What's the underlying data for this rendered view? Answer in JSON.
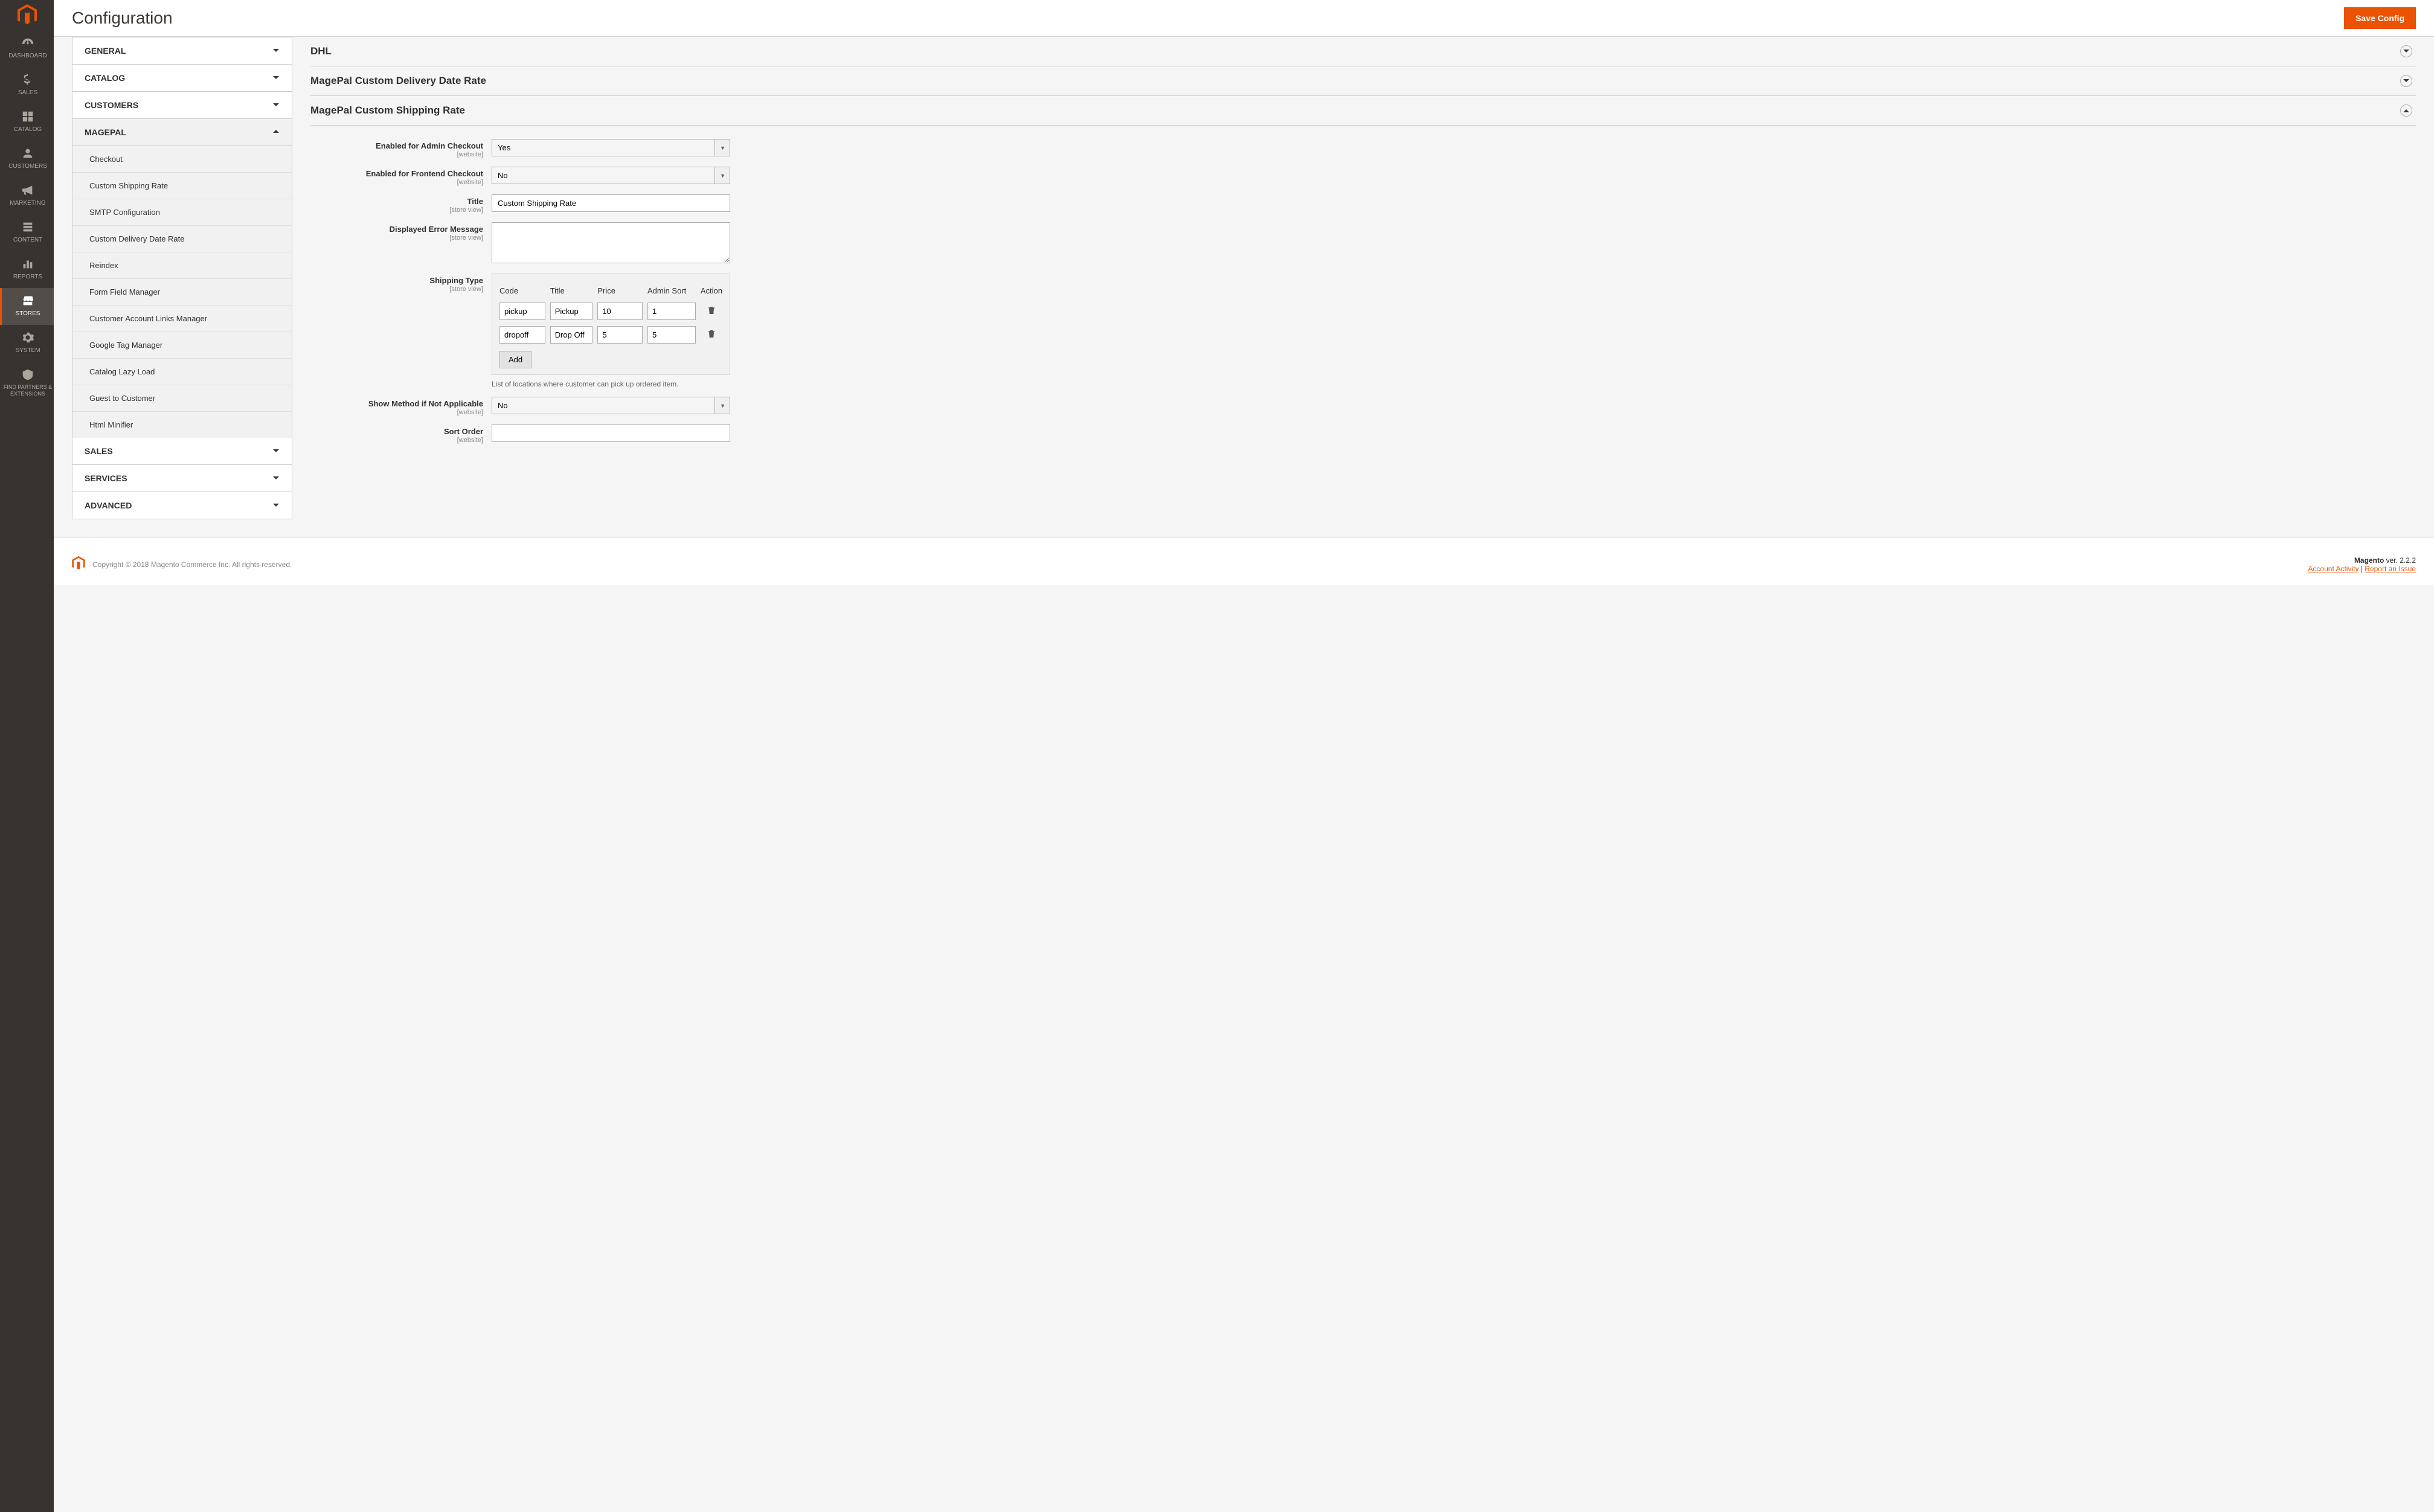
{
  "pageTitle": "Configuration",
  "saveButton": "Save Config",
  "sidebar": {
    "items": [
      {
        "label": "Dashboard"
      },
      {
        "label": "Sales"
      },
      {
        "label": "Catalog"
      },
      {
        "label": "Customers"
      },
      {
        "label": "Marketing"
      },
      {
        "label": "Content"
      },
      {
        "label": "Reports"
      },
      {
        "label": "Stores"
      },
      {
        "label": "System"
      },
      {
        "label": "Find Partners & Extensions"
      }
    ]
  },
  "configNav": {
    "groups": [
      {
        "label": "General"
      },
      {
        "label": "Catalog"
      },
      {
        "label": "Customers"
      },
      {
        "label": "MagePal",
        "expanded": true,
        "items": [
          "Checkout",
          "Custom Shipping Rate",
          "SMTP Configuration",
          "Custom Delivery Date Rate",
          "Reindex",
          "Form Field Manager",
          "Customer Account Links Manager",
          "Google Tag Manager",
          "Catalog Lazy Load",
          "Guest to Customer",
          "Html Minifier"
        ]
      },
      {
        "label": "Sales"
      },
      {
        "label": "Services"
      },
      {
        "label": "Advanced"
      }
    ]
  },
  "sections": {
    "dhl": "DHL",
    "mcdr": "MagePal Custom Delivery Date Rate",
    "mcsr": "MagePal Custom Shipping Rate"
  },
  "form": {
    "enabledAdmin": {
      "label": "Enabled for Admin Checkout",
      "scope": "[website]",
      "value": "Yes"
    },
    "enabledFrontend": {
      "label": "Enabled for Frontend Checkout",
      "scope": "[website]",
      "value": "No"
    },
    "title": {
      "label": "Title",
      "scope": "[store view]",
      "value": "Custom Shipping Rate"
    },
    "errorMsg": {
      "label": "Displayed Error Message",
      "scope": "[store view]",
      "value": ""
    },
    "shippingType": {
      "label": "Shipping Type",
      "scope": "[store view]",
      "hint": "List of locations where customer can pick up ordered item."
    },
    "showIfNA": {
      "label": "Show Method if Not Applicable",
      "scope": "[website]",
      "value": "No"
    },
    "sortOrder": {
      "label": "Sort Order",
      "scope": "[website]",
      "value": ""
    }
  },
  "shipTable": {
    "headers": {
      "code": "Code",
      "title": "Title",
      "price": "Price",
      "sort": "Admin Sort",
      "action": "Action"
    },
    "rows": [
      {
        "code": "pickup",
        "title": "Pickup",
        "price": "10",
        "sort": "1"
      },
      {
        "code": "dropoff",
        "title": "Drop Off",
        "price": "5",
        "sort": "5"
      }
    ],
    "addLabel": "Add"
  },
  "footer": {
    "copyright": "Copyright © 2018 Magento Commerce Inc. All rights reserved.",
    "versionLabel": "Magento",
    "versionValue": "ver. 2.2.2",
    "accountActivity": "Account Activity",
    "reportIssue": "Report an Issue"
  }
}
